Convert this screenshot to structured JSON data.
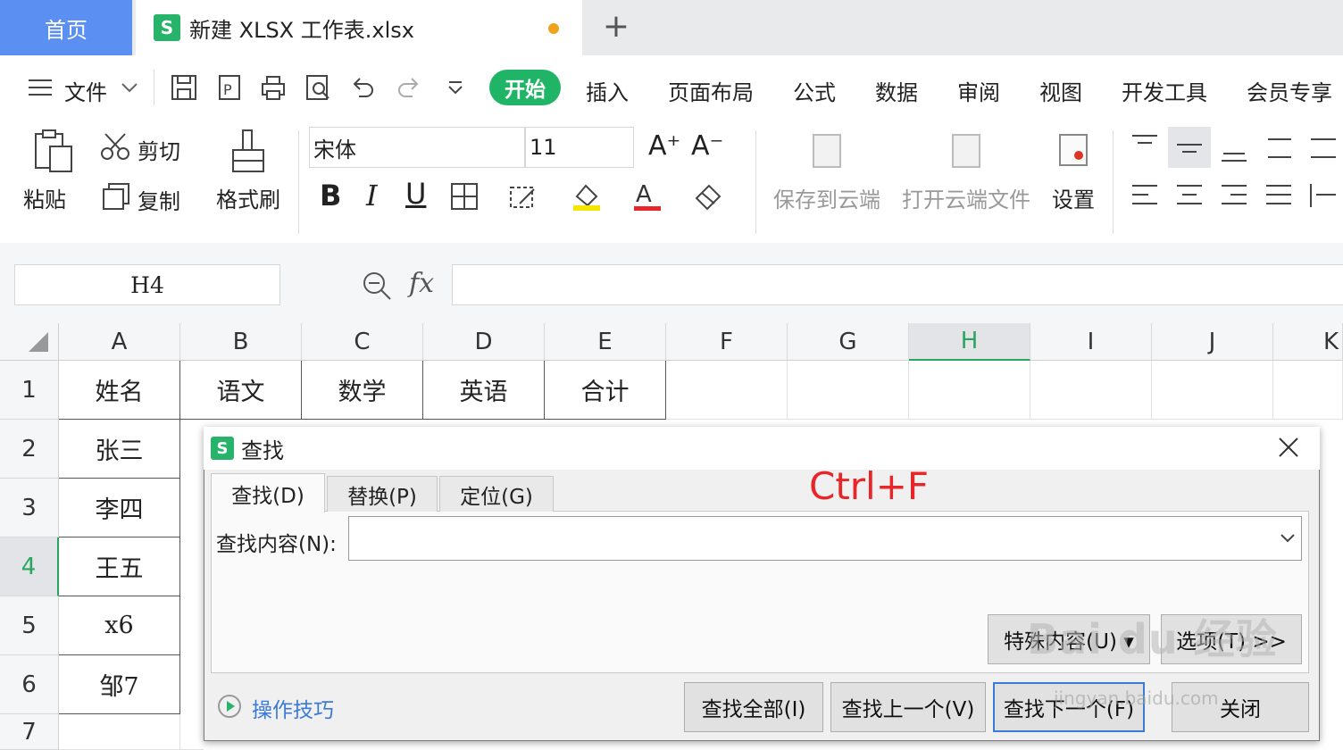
{
  "tabs": {
    "home": "首页",
    "file": "新建 XLSX 工作表.xlsx",
    "new_tab": "+"
  },
  "menu": {
    "file": "文件",
    "items": [
      "开始",
      "插入",
      "页面布局",
      "公式",
      "数据",
      "审阅",
      "视图",
      "开发工具",
      "会员专享"
    ]
  },
  "ribbon": {
    "paste": "粘贴",
    "cut": "剪切",
    "copy": "复制",
    "format_painter": "格式刷",
    "font_name": "宋体",
    "font_size": "11",
    "save_cloud": "保存到云端",
    "open_cloud": "打开云端文件",
    "settings": "设置"
  },
  "formula_bar": {
    "name_box": "H4",
    "fx": "fx",
    "formula": ""
  },
  "columns": [
    "A",
    "B",
    "C",
    "D",
    "E",
    "F",
    "G",
    "H",
    "I",
    "J",
    "K"
  ],
  "rows": [
    "1",
    "2",
    "3",
    "4",
    "5",
    "6",
    "7"
  ],
  "cells": {
    "A1": "姓名",
    "B1": "语文",
    "C1": "数学",
    "D1": "英语",
    "E1": "合计",
    "A2": "张三",
    "A3": "李四",
    "A4": "王五",
    "A5": "x6",
    "A6": "邹7"
  },
  "dialog": {
    "title": "查找",
    "tabs": [
      "查找(D)",
      "替换(P)",
      "定位(G)"
    ],
    "find_label": "查找内容(N):",
    "find_value": "",
    "special_button": "特殊内容(U) ▾",
    "options_button": "选项(T) >>",
    "find_all": "查找全部(I)",
    "find_prev": "查找上一个(V)",
    "find_next": "查找下一个(F)",
    "close": "关闭",
    "tips": "操作技巧"
  },
  "annotation": "Ctrl+F",
  "watermark": {
    "logo": "Bai du 经验",
    "url": "jingyan.baidu.com"
  },
  "colors": {
    "brand_green": "#20b466",
    "home_blue": "#5b8ff2",
    "annotation_red": "#e8262a",
    "active_header": "#2aa55e"
  }
}
